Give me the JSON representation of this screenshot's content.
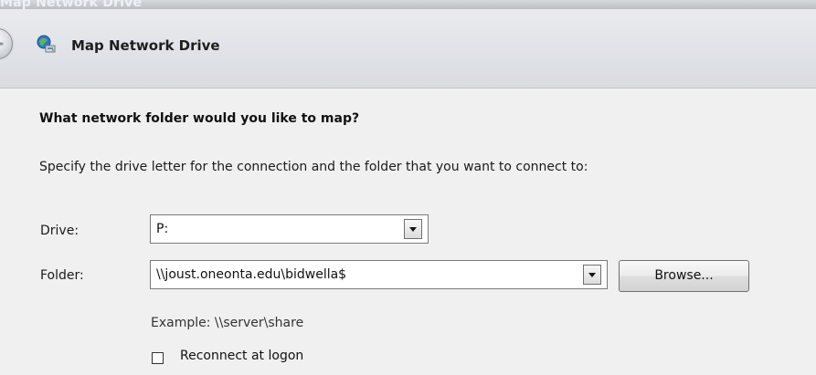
{
  "window": {
    "title": "Map Network Drive"
  },
  "header": {
    "title": "Map Network Drive",
    "icon": "network-drive-icon",
    "back_icon": "back-arrow-icon"
  },
  "content": {
    "question": "What network folder would you like to map?",
    "instruction": "Specify the drive letter for the connection and the folder that you want to connect to:",
    "drive": {
      "label": "Drive:",
      "value": "P:"
    },
    "folder": {
      "label": "Folder:",
      "value": "\\\\joust.oneonta.edu\\bidwella$"
    },
    "browse_label": "Browse...",
    "example": "Example: \\\\server\\share",
    "reconnect": {
      "label": "Reconnect at logon",
      "checked": false
    }
  },
  "colors": {
    "background": "#f0f0f0",
    "header": "#dfe2e6",
    "text": "#1b1b1b",
    "border": "#7a7a7a"
  }
}
